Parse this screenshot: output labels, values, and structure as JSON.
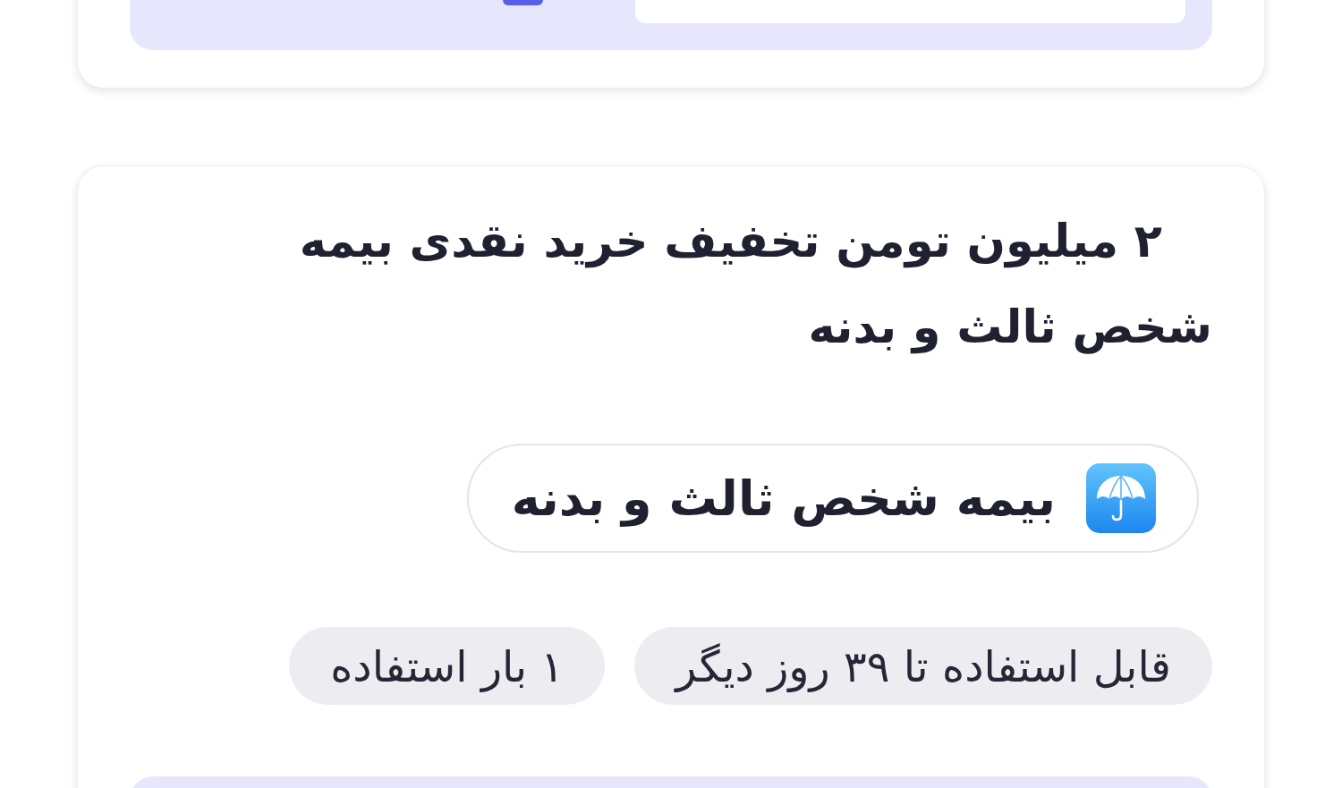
{
  "offer_card": {
    "title": "۲ میلیون تومن تخفیف خرید نقدی بیمه شخص ثالث و بدنه",
    "category": {
      "label": "بیمه شخص ثالث و بدنه"
    },
    "tags": [
      {
        "label": "قابل استفاده تا ۳۹ روز دیگر"
      },
      {
        "label": "۱ بار استفاده"
      }
    ]
  }
}
